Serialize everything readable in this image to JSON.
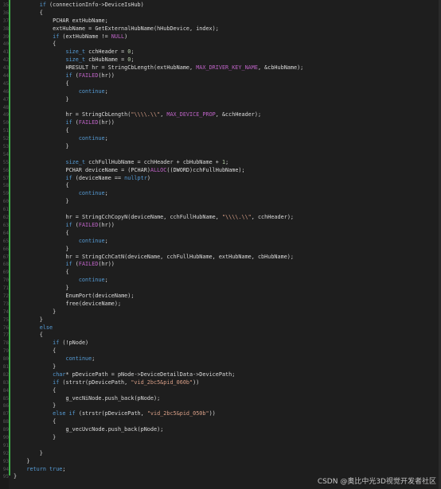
{
  "editor": {
    "line_numbers": [
      "35",
      "36",
      "37",
      "38",
      "39",
      "40",
      "41",
      "42",
      "43",
      "44",
      "45",
      "46",
      "47",
      "48",
      "49",
      "50",
      "51",
      "52",
      "53",
      "54",
      "55",
      "56",
      "57",
      "58",
      "59",
      "60",
      "61",
      "62",
      "63",
      "64",
      "65",
      "66",
      "67",
      "68",
      "69",
      "70",
      "71",
      "72",
      "73",
      "74",
      "75",
      "76",
      "77",
      "78",
      "79",
      "80",
      "81",
      "82",
      "83",
      "84",
      "85",
      "86",
      "87",
      "88",
      "89",
      "90",
      "91",
      "92",
      "93",
      "94",
      "95"
    ],
    "lines": [
      "        if (connectionInfo->DeviceIsHub)",
      "        {",
      "            PCHAR extHubName;",
      "            extHubName = GetExternalHubName(hHubDevice, index);",
      "            if (extHubName != NULL)",
      "            {",
      "                size_t cchHeader = 0;",
      "                size_t cbHubName = 0;",
      "                HRESULT hr = StringCbLength(extHubName, MAX_DRIVER_KEY_NAME, &cbHubName);",
      "                if (FAILED(hr))",
      "                {",
      "                    continue;",
      "                }",
      "",
      "                hr = StringCbLength(\"\\\\\\\\.\\\\\", MAX_DEVICE_PROP, &cchHeader);",
      "                if (FAILED(hr))",
      "                {",
      "                    continue;",
      "                }",
      "",
      "                size_t cchFullHubName = cchHeader + cbHubName + 1;",
      "                PCHAR deviceName = (PCHAR)ALLOC((DWORD)cchFullHubName);",
      "                if (deviceName == nullptr)",
      "                {",
      "                    continue;",
      "                }",
      "",
      "                hr = StringCchCopyN(deviceName, cchFullHubName, \"\\\\\\\\.\\\\\", cchHeader);",
      "                if (FAILED(hr))",
      "                {",
      "                    continue;",
      "                }",
      "                hr = StringCchCatN(deviceName, cchFullHubName, extHubName, cbHubName);",
      "                if (FAILED(hr))",
      "                {",
      "                    continue;",
      "                }",
      "                EnumPort(deviceName);",
      "                free(deviceName);",
      "            }",
      "        }",
      "        else",
      "        {",
      "            if (!pNode)",
      "            {",
      "                continue;",
      "            }",
      "            char* pDevicePath = pNode->DeviceDetailData->DevicePath;",
      "            if (strstr(pDevicePath, \"vid_2bc5&pid_060b\"))",
      "            {",
      "                g_vecNiNode.push_back(pNode);",
      "            }",
      "            else if (strstr(pDevicePath, \"vid_2bc5&pid_050b\"))",
      "            {",
      "                g_vecUvcNode.push_back(pNode);",
      "            }",
      "",
      "        }",
      "    }",
      "    return true;",
      "}"
    ]
  },
  "watermark": "CSDN @奥比中光3D视觉开发者社区",
  "colors": {
    "background": "#1e1e1e",
    "text": "#dcdcdc",
    "keyword": "#569cd6",
    "macro": "#bd63c5",
    "string": "#d69d85",
    "change_bar": "#3fae49"
  }
}
